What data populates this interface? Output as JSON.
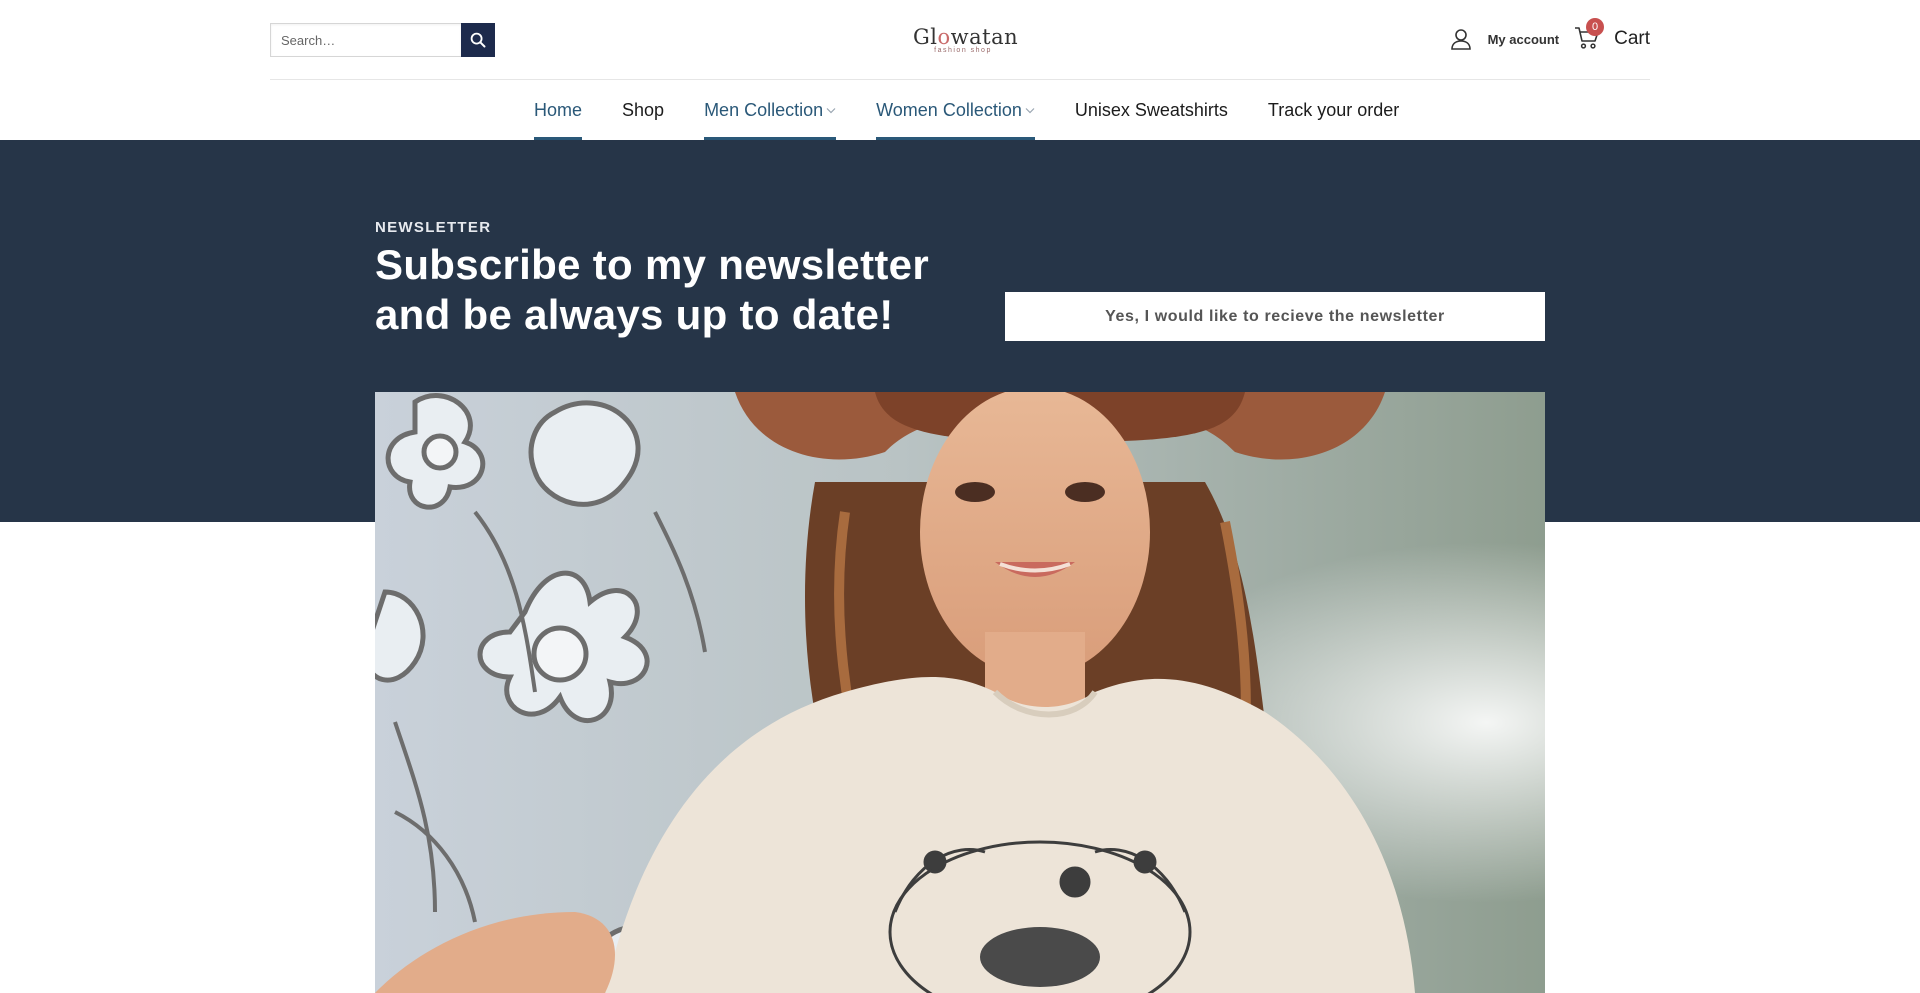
{
  "header": {
    "search": {
      "placeholder": "Search…",
      "button_icon": "search-icon"
    },
    "logo": {
      "word_part1": "Gl",
      "word_o": "o",
      "word_part2": "watan",
      "tagline": "fashion shop"
    },
    "account": {
      "icon": "user-icon",
      "label": "My account"
    },
    "cart": {
      "icon": "cart-icon",
      "count": "0",
      "label": "Cart"
    }
  },
  "nav": {
    "items": [
      {
        "label": "Home",
        "active": true,
        "dropdown": false
      },
      {
        "label": "Shop",
        "active": false,
        "dropdown": false
      },
      {
        "label": "Men Collection",
        "active": true,
        "dropdown": true
      },
      {
        "label": "Women Collection",
        "active": true,
        "dropdown": true
      },
      {
        "label": "Unisex Sweatshirts",
        "active": false,
        "dropdown": false
      },
      {
        "label": "Track your order",
        "active": false,
        "dropdown": false
      }
    ]
  },
  "newsletter": {
    "kicker": "NEWSLETTER",
    "title_line1": "Subscribe to my newsletter",
    "title_line2": "and be always up to date!",
    "button_label": "Yes, I would like to recieve the newsletter"
  },
  "colors": {
    "band": "#263548",
    "accent": "#2a5878",
    "search_button": "#1d2a4c",
    "cart_badge": "#c8504f"
  }
}
